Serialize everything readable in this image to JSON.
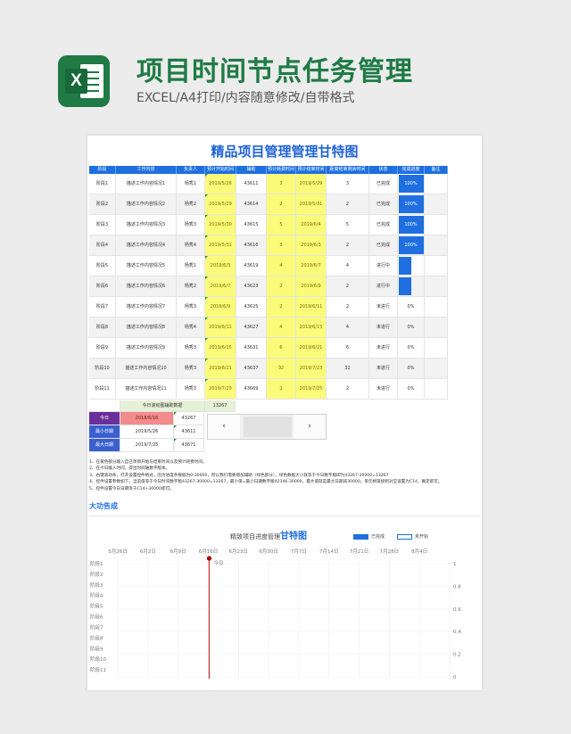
{
  "header": {
    "title": "项目时间节点任务管理",
    "subtitle": "EXCEL/A4打印/内容随意修改/自带格式",
    "logo_letter": "X"
  },
  "sheet": {
    "title": "精品项目管理管理甘特图",
    "columns": [
      "阶段",
      "工作内容",
      "负责人",
      "预计开始时间",
      "辅助",
      "预计耗费时间",
      "预计结束时间",
      "距离结束剩余时间",
      "状态",
      "完成进度",
      "备注"
    ],
    "rows": [
      {
        "stage": "阶段1",
        "task": "描述工作内容情况1",
        "owner": "杨秀1",
        "start": "2019/5/26",
        "aux": "43611",
        "days": "3",
        "end": "2019/5/29",
        "remaining": "3",
        "status": "已完成",
        "progress": "100%",
        "progress_value": 1.0,
        "note": ""
      },
      {
        "stage": "阶段2",
        "task": "描述工作内容情况2",
        "owner": "杨秀2",
        "start": "2019/5/29",
        "aux": "43614",
        "days": "2",
        "end": "2019/5/31",
        "remaining": "2",
        "status": "已完成",
        "progress": "100%",
        "progress_value": 1.0,
        "note": ""
      },
      {
        "stage": "阶段3",
        "task": "描述工作内容情况3",
        "owner": "杨秀3",
        "start": "2019/5/30",
        "aux": "43615",
        "days": "5",
        "end": "2019/6/4",
        "remaining": "5",
        "status": "已完成",
        "progress": "100%",
        "progress_value": 1.0,
        "note": ""
      },
      {
        "stage": "阶段4",
        "task": "描述工作内容情况4",
        "owner": "杨秀4",
        "start": "2019/5/31",
        "aux": "43616",
        "days": "3",
        "end": "2019/6/3",
        "remaining": "2",
        "status": "已完成",
        "progress": "100%",
        "progress_value": 1.0,
        "note": ""
      },
      {
        "stage": "阶段5",
        "task": "描述工作内容情况5",
        "owner": "杨秀1",
        "start": "2019/6/3",
        "aux": "43619",
        "days": "4",
        "end": "2019/6/7",
        "remaining": "4",
        "status": "进行中",
        "progress": "",
        "progress_value": 0.5,
        "note": ""
      },
      {
        "stage": "阶段6",
        "task": "描述工作内容情况6",
        "owner": "杨秀2",
        "start": "2019/6/7",
        "aux": "43623",
        "days": "2",
        "end": "2019/6/9",
        "remaining": "2",
        "status": "进行中",
        "progress": "",
        "progress_value": 0.5,
        "note": ""
      },
      {
        "stage": "阶段7",
        "task": "描述工作内容情况7",
        "owner": "杨秀3",
        "start": "2019/6/9",
        "aux": "43625",
        "days": "2",
        "end": "2019/6/11",
        "remaining": "2",
        "status": "未进行",
        "progress": "0%",
        "progress_value": 0,
        "note": ""
      },
      {
        "stage": "阶段8",
        "task": "描述工作内容情况8",
        "owner": "杨秀4",
        "start": "2019/6/11",
        "aux": "43627",
        "days": "4",
        "end": "2019/6/15",
        "remaining": "4",
        "status": "未进行",
        "progress": "0%",
        "progress_value": 0,
        "note": ""
      },
      {
        "stage": "阶段9",
        "task": "描述工作内容情况9",
        "owner": "杨秀3",
        "start": "2019/6/15",
        "aux": "43631",
        "days": "6",
        "end": "2019/6/21",
        "remaining": "6",
        "status": "未进行",
        "progress": "0%",
        "progress_value": 0,
        "note": ""
      },
      {
        "stage": "阶段10",
        "task": "描述工作内容情况10",
        "owner": "杨秀3",
        "start": "2019/6/21",
        "aux": "43637",
        "days": "32",
        "end": "2019/7/23",
        "remaining": "32",
        "status": "未进行",
        "progress": "0%",
        "progress_value": 0,
        "note": ""
      },
      {
        "stage": "阶段11",
        "task": "描述工作内容情况11",
        "owner": "杨秀3",
        "start": "2019/7/23",
        "aux": "43669",
        "days": "2",
        "end": "2019/7/25",
        "remaining": "2",
        "status": "未进行",
        "progress": "0%",
        "progress_value": 0,
        "note": ""
      }
    ],
    "helper": {
      "scroll_label": "今日滚动图辅助数据",
      "scroll_value": "13267",
      "today_label": "今日",
      "today_date": "2018/6/16",
      "today_value": "43267",
      "min_label": "最小日期",
      "min_date": "2019/5/26",
      "min_value": "43611",
      "max_label": "最大日期",
      "max_date": "2019/7/25",
      "max_value": "43671"
    },
    "scroll": {
      "left_arrow": "‹",
      "right_arrow": "›"
    },
    "notes": [
      "1、在黄色部分输入自己项目开始与结束时间以及预计耗费时间。",
      "2、在今日输入时间，得出时间轴数字版本。",
      "3、右键滚动条，打开设置控件格式，因为进度条数据为0-30000，所以我们需要增加辅助（绿色部分），绿色数据大小就等于今日数字版即为43267-30000=13267",
      "4、控件设置参数如下，当前值等于今日时间数字版43267-30000=13267，最小值=最小日期数字版42346-30000，最大值就是最大日期减30000，单元格链接到对应设置为C14，确定即可。",
      "5、控件设置今日日期等于C14+30000即可。"
    ],
    "done_text": "大功告成"
  },
  "gantt": {
    "title_prefix": "精致项目进度管理",
    "title_bold": "甘特图",
    "legend_done": "已完成",
    "legend_todo": "未开始",
    "today_label": "今日"
  },
  "colors": {
    "header_blue": "#1f6fe0",
    "input_yellow": "#fbfb7a",
    "helper_green": "#e6f1d8",
    "today_purple": "#6b2f9b",
    "today_red": "#f28b8b",
    "date_blue": "#3b5fd0",
    "excel_green": "#1e7b45",
    "today_line": "#d03030"
  },
  "chart_data": {
    "type": "bar",
    "title": "精致项目进度管理甘特图",
    "categories": [
      "阶段1",
      "阶段2",
      "阶段3",
      "阶段4",
      "阶段5",
      "阶段6",
      "阶段7",
      "阶段8",
      "阶段9",
      "阶段10",
      "阶段11"
    ],
    "x_ticks": [
      "5月26日",
      "6月2日",
      "6月9日",
      "6月16日",
      "6月23日",
      "6月30日",
      "7月7日",
      "7月14日",
      "7月21日",
      "7月28日",
      "8月4日"
    ],
    "y2_ticks": [
      "1",
      "0.8",
      "0.6",
      "0.4",
      "0.2",
      "0"
    ],
    "series": [
      {
        "name": "已完成",
        "values": [
          0,
          0,
          0,
          0,
          0,
          0,
          0,
          0,
          0,
          0,
          0
        ]
      },
      {
        "name": "未开始",
        "values": [
          0,
          0,
          0,
          0,
          0,
          0,
          0,
          0,
          0,
          0,
          0
        ]
      }
    ],
    "today_marker_x": "6月16日",
    "legend_position": "top-right",
    "grid": true
  }
}
